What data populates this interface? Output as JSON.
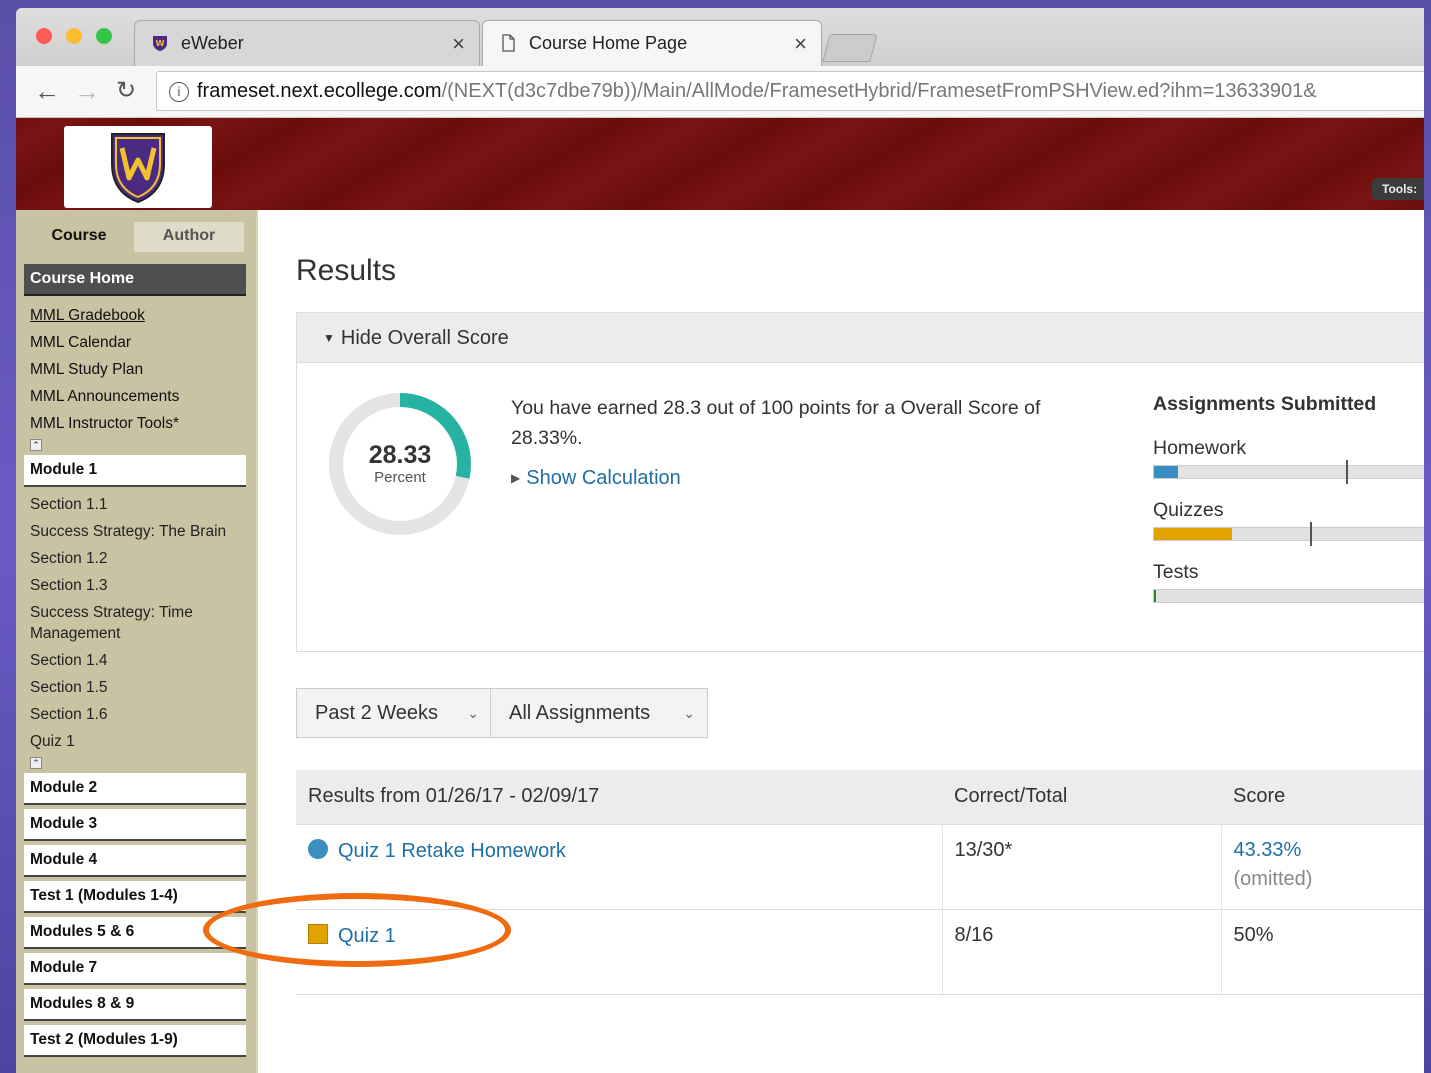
{
  "browser": {
    "tabs": [
      {
        "title": "eWeber",
        "active": false
      },
      {
        "title": "Course Home Page",
        "active": true
      }
    ],
    "url_host": "frameset.next.ecollege.com",
    "url_path": "/(NEXT(d3c7dbe79b))/Main/AllMode/FramesetHybrid/FramesetFromPSHView.ed?ihm=13633901&"
  },
  "header": {
    "tools_label": "Tools:",
    "accent_color": "#6a0d0d"
  },
  "leftnav": {
    "tab_course": "Course",
    "tab_author": "Author",
    "course_home": "Course Home",
    "links": [
      "MML Gradebook",
      "MML Calendar",
      "MML Study Plan",
      "MML Announcements",
      "MML Instructor Tools*"
    ],
    "module1": {
      "title": "Module 1",
      "items": [
        "Section 1.1",
        "Success Strategy: The Brain",
        "Section 1.2",
        "Section 1.3",
        "Success Strategy: Time Management",
        "Section 1.4",
        "Section 1.5",
        "Section 1.6",
        "Quiz 1"
      ]
    },
    "modules": [
      "Module 2",
      "Module 3",
      "Module 4",
      "Test 1 (Modules 1-4)",
      "Modules 5 & 6",
      "Module 7",
      "Modules 8 & 9",
      "Test 2 (Modules 1-9)"
    ]
  },
  "main": {
    "title": "Results",
    "overall_toggle": "Hide Overall Score",
    "score_value": "28.33",
    "score_label": "Percent",
    "score_percent": 28.33,
    "earned_text": "You have earned 28.3 out of 100 points for a Overall Score of 28.33%.",
    "show_calculation": "Show Calculation",
    "assignments_title": "Assignments Submitted",
    "assignments": [
      {
        "label": "Homework",
        "fill": 0.08,
        "color": "#3a8fc2",
        "marker": 0.64
      },
      {
        "label": "Quizzes",
        "fill": 0.26,
        "color": "#e2a200",
        "marker": 0.52
      },
      {
        "label": "Tests",
        "fill": 0.005,
        "color": "#2a8a2a",
        "marker": null
      }
    ],
    "filter_period": "Past 2 Weeks",
    "filter_type": "All Assignments",
    "table": {
      "headers": [
        "Results from 01/26/17 - 02/09/17",
        "Correct/Total",
        "Score"
      ],
      "rows": [
        {
          "name": "Quiz 1 Retake Homework",
          "correct": "13/30*",
          "score": "43.33%",
          "note": "(omitted)"
        },
        {
          "name": "Quiz 1",
          "correct": "8/16",
          "score": "50%",
          "note": ""
        }
      ]
    }
  }
}
